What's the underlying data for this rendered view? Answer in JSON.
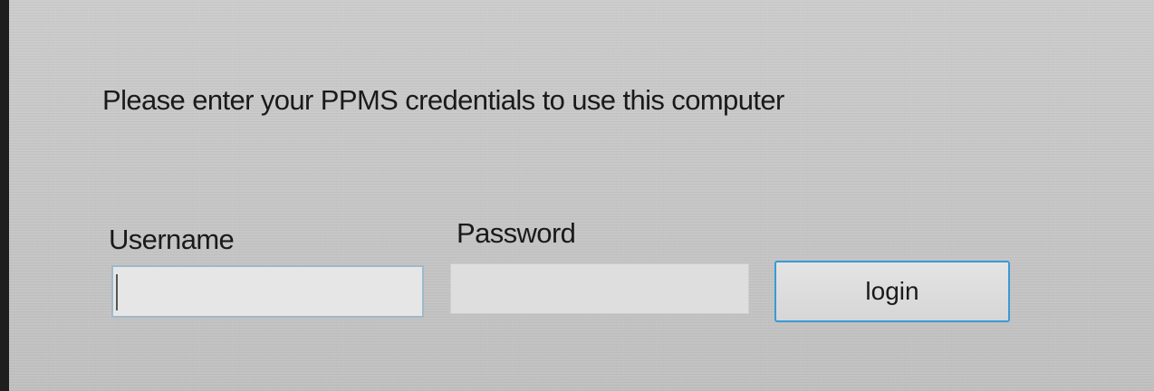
{
  "login_form": {
    "instruction": "Please enter your PPMS credentials to use this computer",
    "username": {
      "label": "Username",
      "value": "",
      "placeholder": ""
    },
    "password": {
      "label": "Password",
      "value": "",
      "placeholder": ""
    },
    "login_button_label": "login"
  }
}
